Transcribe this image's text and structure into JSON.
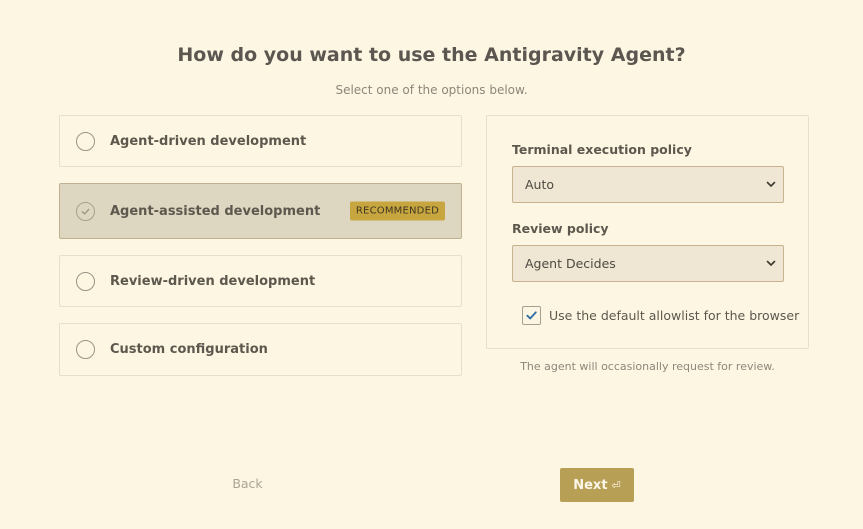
{
  "header": {
    "title": "How do you want to use the Antigravity Agent?",
    "subtitle": "Select one of the options below."
  },
  "options": [
    {
      "label": "Agent-driven development",
      "selected": false
    },
    {
      "label": "Agent-assisted development",
      "selected": true,
      "badge": "RECOMMENDED"
    },
    {
      "label": "Review-driven development",
      "selected": false
    },
    {
      "label": "Custom configuration",
      "selected": false
    }
  ],
  "settings": {
    "terminal_label": "Terminal execution policy",
    "terminal_value": "Auto",
    "review_label": "Review policy",
    "review_value": "Agent Decides",
    "allowlist_label": "Use the default allowlist for the browser",
    "allowlist_checked": true,
    "hint": "The agent will occasionally request for review."
  },
  "footer": {
    "back_label": "Back",
    "next_label": "Next",
    "next_icon": "enter-icon"
  },
  "colors": {
    "background": "#fdf6e3",
    "accent": "#b89f56",
    "badge": "#c7a63f",
    "checkbox_tick": "#2f6fa3"
  }
}
